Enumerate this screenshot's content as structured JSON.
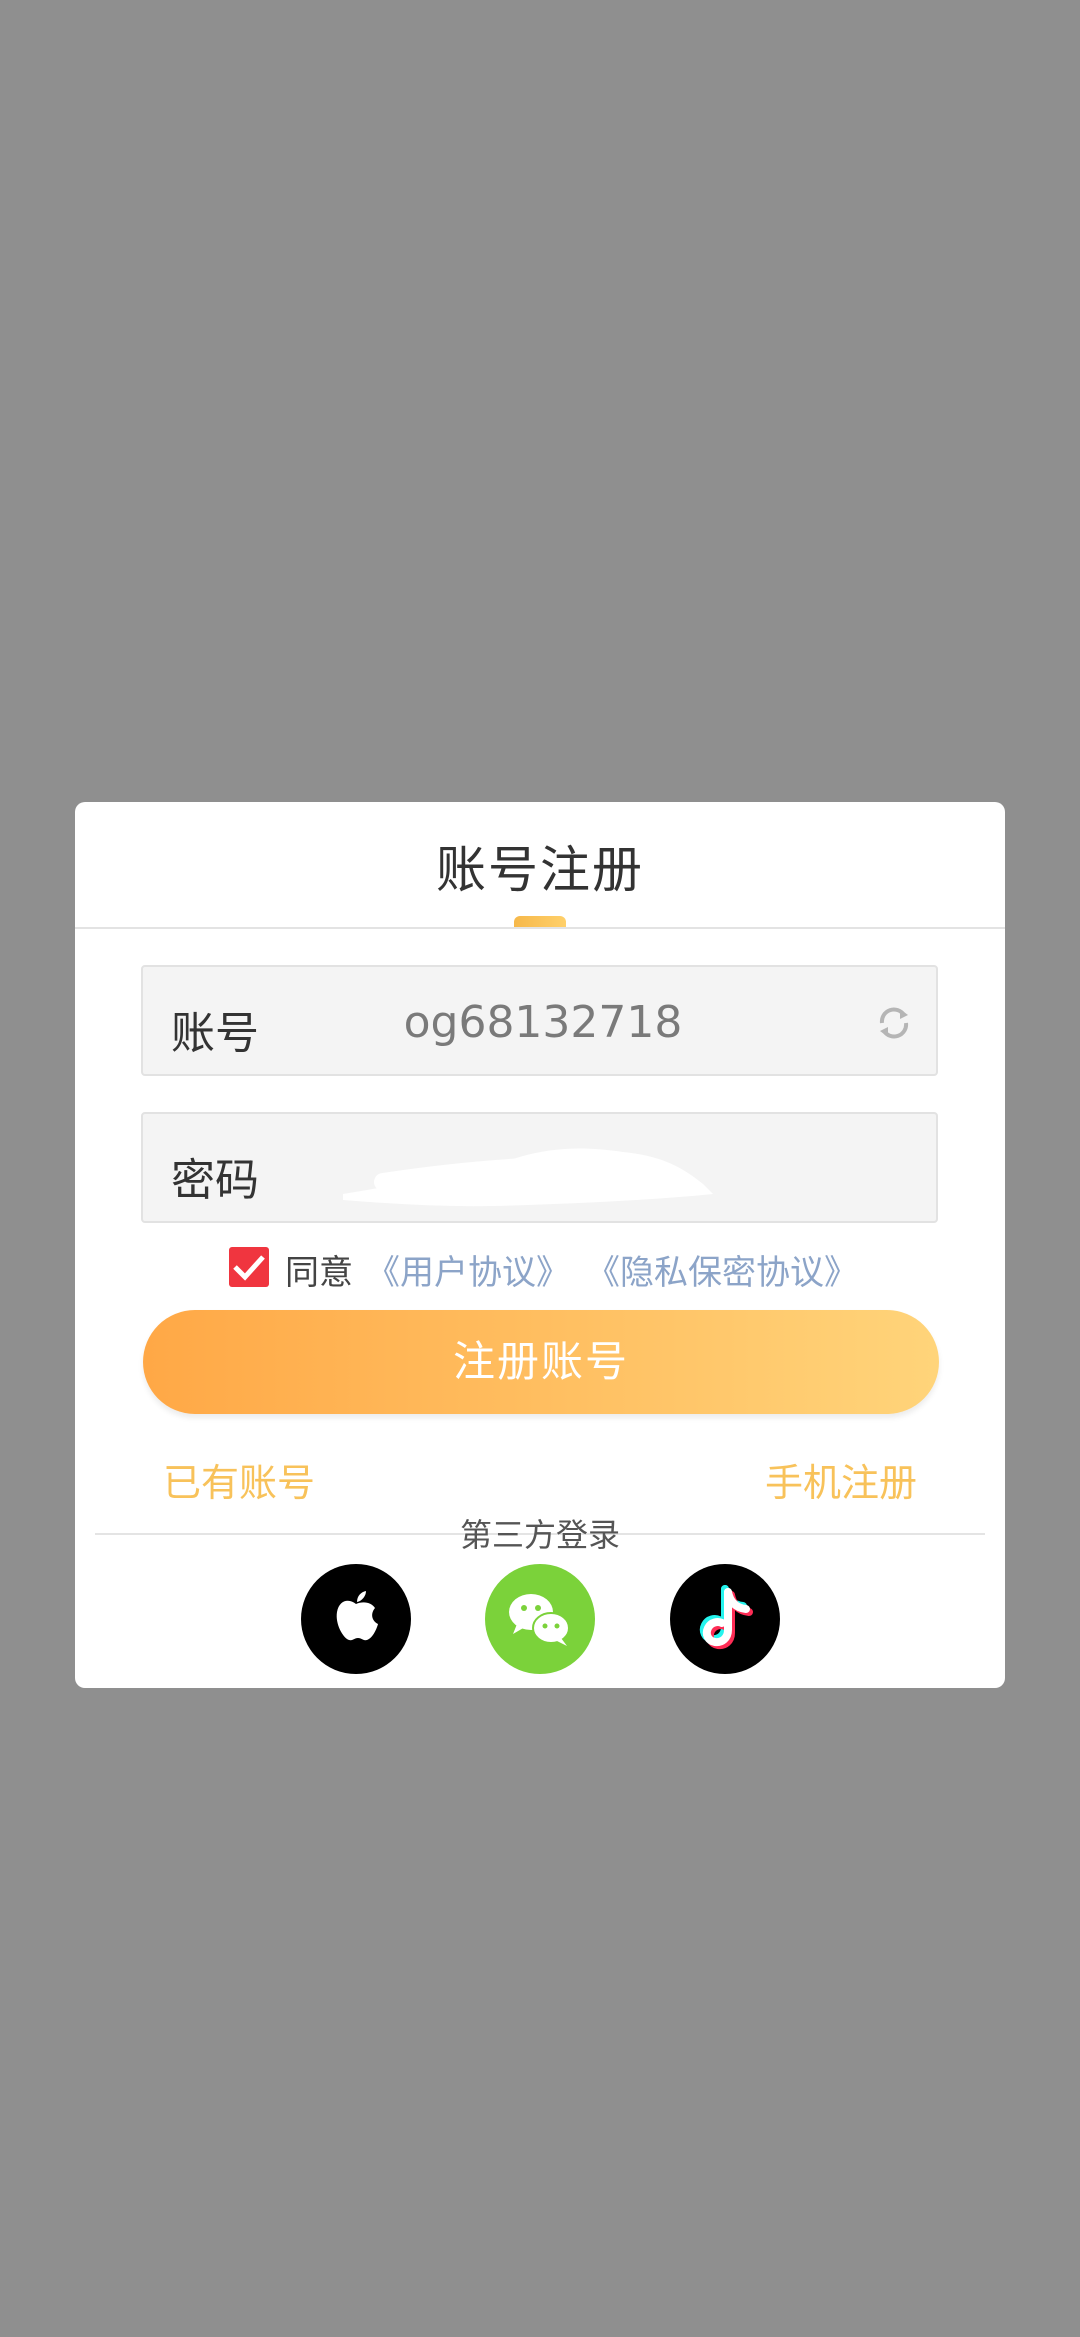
{
  "dialog": {
    "title": "账号注册"
  },
  "account_field": {
    "label": "账号",
    "value": "og68132718",
    "refresh_icon": "refresh-icon"
  },
  "password_field": {
    "label": "密码",
    "value_masked": true
  },
  "agreement": {
    "checked": true,
    "agree_text": "同意",
    "user_agreement": "《用户协议》",
    "privacy_agreement": "《隐私保密协议》"
  },
  "register_button": "注册账号",
  "links": {
    "have_account": "已有账号",
    "phone_register": "手机注册"
  },
  "third_party": {
    "label": "第三方登录",
    "providers": [
      "apple-icon",
      "wechat-icon",
      "tiktok-icon"
    ]
  },
  "colors": {
    "backdrop": "#8f8f8f",
    "accent": "#ffb850",
    "link": "#8ca4c8",
    "checkbox": "#f0353f",
    "wechat": "#7bd23a"
  }
}
